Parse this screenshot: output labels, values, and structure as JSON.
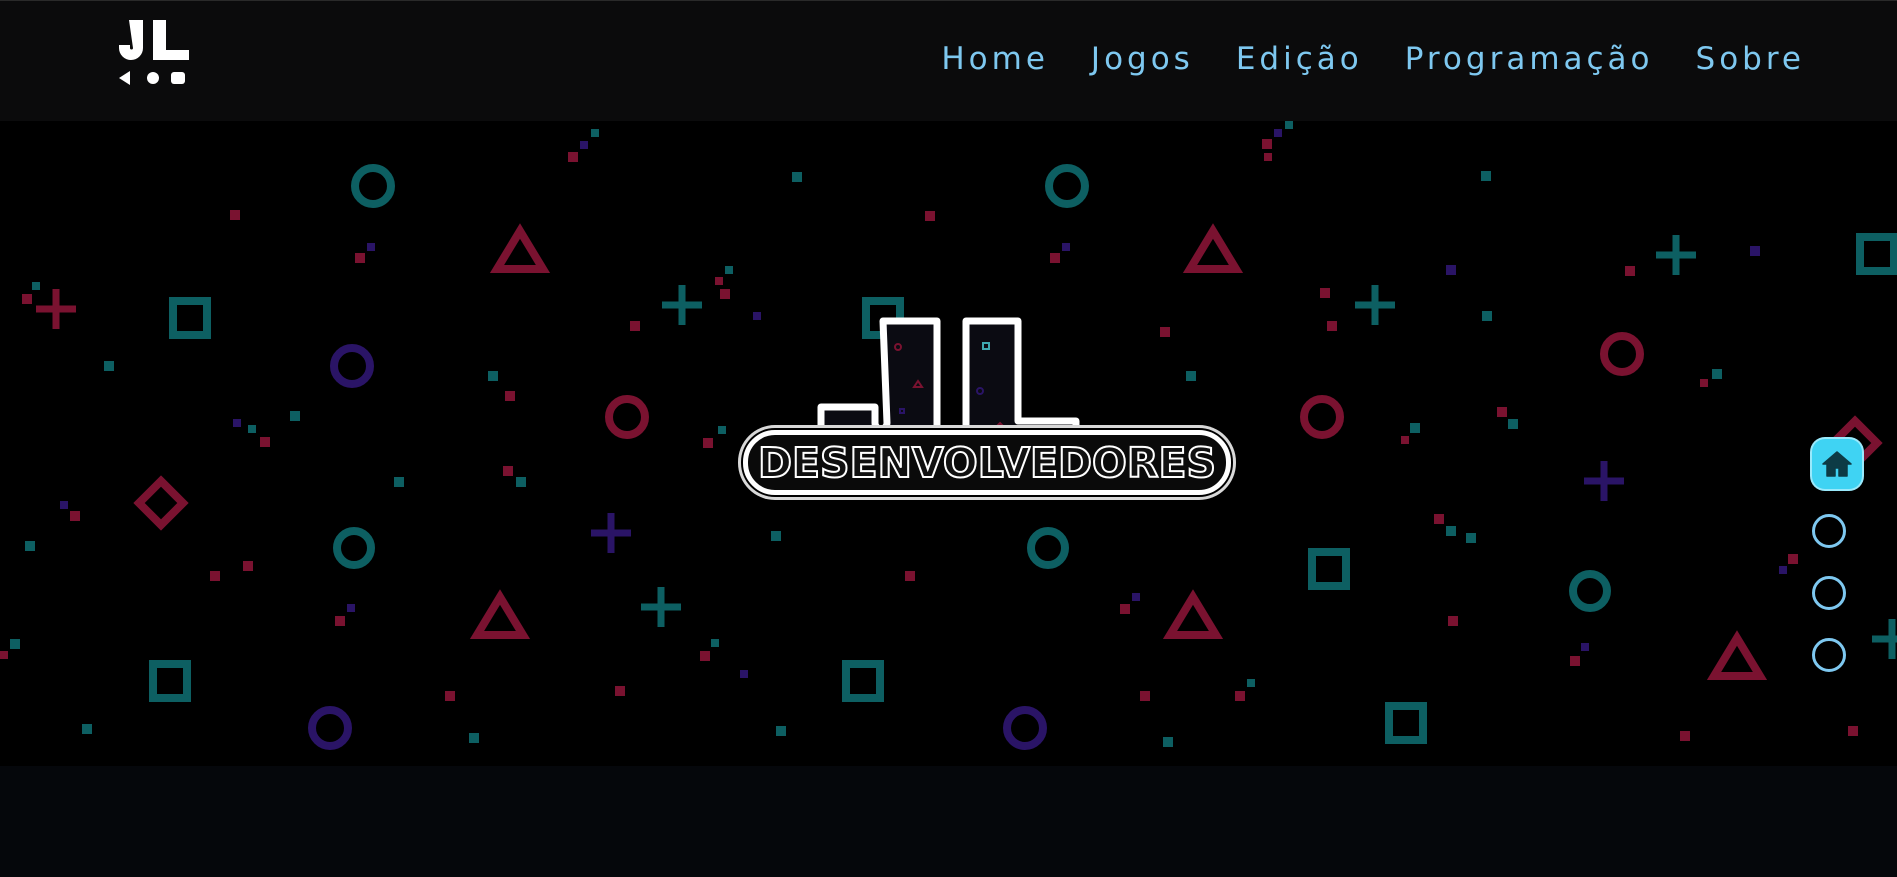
{
  "navbar": {
    "logo_text": "JL",
    "links": [
      {
        "label": "Home"
      },
      {
        "label": "Jogos"
      },
      {
        "label": "Edição"
      },
      {
        "label": "Programação"
      },
      {
        "label": "Sobre"
      }
    ]
  },
  "hero": {
    "logo_text": "JL",
    "brand_text": "Desenvolvedores"
  },
  "side_nav": {
    "active_icon": "home-icon",
    "item_count": 4,
    "active_index": 0
  },
  "colors": {
    "nav_link": "#7ec8f0",
    "accent_cyan": "#3fd3f3",
    "shape_teal": "#0d5f62",
    "shape_red": "#7a1230",
    "shape_purple": "#2a1466",
    "navbar_bg": "#0b0b0c"
  }
}
